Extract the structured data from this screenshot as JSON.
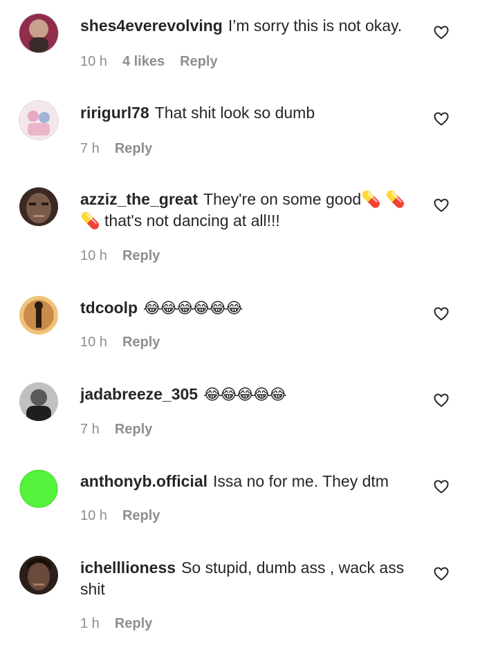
{
  "comments": [
    {
      "username": "shes4everevolving",
      "text": "I’m sorry this is not okay.",
      "time": "10 h",
      "likes": "4 likes",
      "reply": "Reply",
      "avatar_colors": [
        "#8f2d4a",
        "#3b2a2a",
        "#c9a08c"
      ]
    },
    {
      "username": "ririgurl78",
      "text": "That shit look so dumb",
      "time": "7 h",
      "reply": "Reply",
      "avatar_colors": [
        "#f3e7ea",
        "#e7a7c0",
        "#9fb4d8"
      ]
    },
    {
      "username": "azziz_the_great",
      "text": "They're on some good💊 💊 💊 that's not dancing at all!!!",
      "time": "10 h",
      "reply": "Reply",
      "avatar_colors": [
        "#3a2a22",
        "#7a5a48",
        "#b08a72"
      ]
    },
    {
      "username": "tdcoolp",
      "text": "😂😂😂😂😂😂",
      "time": "10 h",
      "reply": "Reply",
      "avatar_colors": [
        "#2a1a10",
        "#c98a4a",
        "#f0c27a"
      ]
    },
    {
      "username": "jadabreeze_305",
      "text": "😂😂😂😂😂",
      "time": "7 h",
      "reply": "Reply",
      "avatar_colors": [
        "#1e1e1e",
        "#5a5a5a",
        "#c0c0c0"
      ]
    },
    {
      "username": "anthonyb.official",
      "text": "Issa no for me. They dtm",
      "time": "10 h",
      "reply": "Reply",
      "avatar_colors": [
        "#55f33b",
        "#55f33b",
        "#55f33b"
      ]
    },
    {
      "username": "ichelllioness",
      "text": "So stupid, dumb ass , wack ass shit",
      "time": "1 h",
      "reply": "Reply",
      "avatar_colors": [
        "#2c1e1a",
        "#6a4a3a",
        "#a37a62"
      ]
    }
  ],
  "icons": {
    "like": "heart-outline-icon"
  }
}
